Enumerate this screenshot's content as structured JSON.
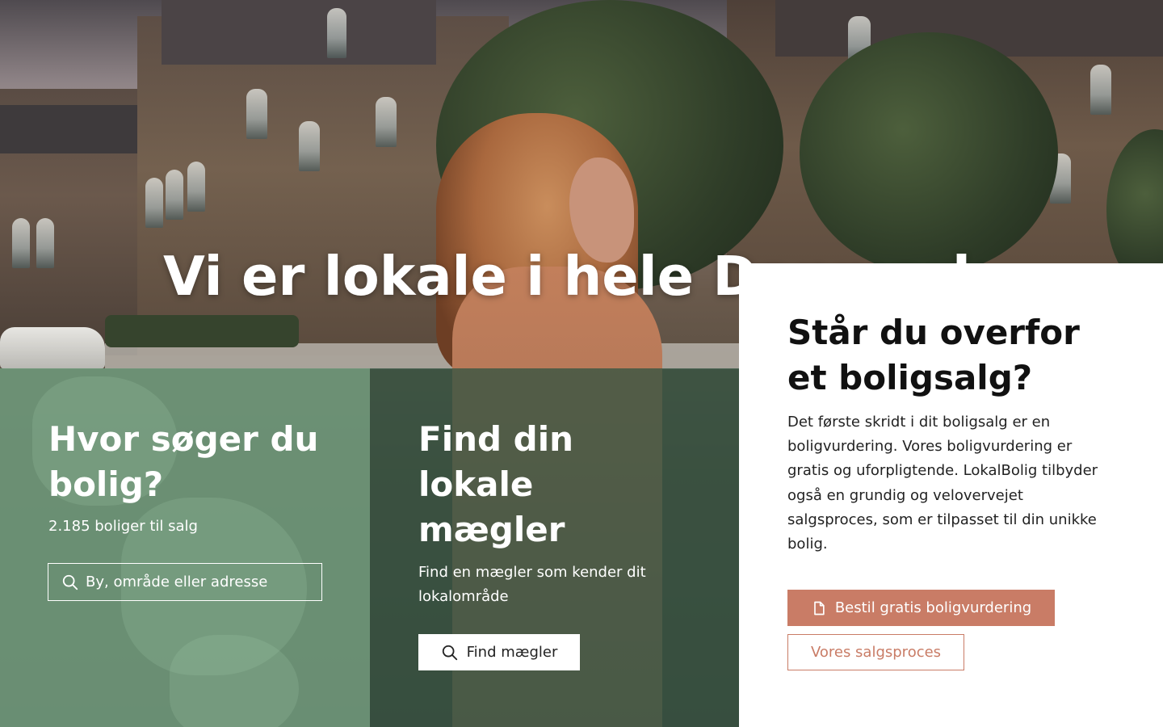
{
  "hero": {
    "headline": "Vi er lokale i hele Danmark"
  },
  "search_panel": {
    "title": "Hvor søger du bolig?",
    "subtitle": "2.185 boliger til salg",
    "search_placeholder": "By, område eller adresse",
    "icon": "search-icon",
    "background_color": "#6e9678"
  },
  "agent_panel": {
    "title": "Find din lokale mægler",
    "subtitle": "Find en mægler som kender dit lokalområde",
    "button_label": "Find mægler",
    "icon": "search-icon",
    "background_color": "#365442"
  },
  "sale_panel": {
    "title": "Står du overfor et boligsalg?",
    "body": "Det første skridt i dit boligsalg er en boligvurdering. Vores boligvurdering er gratis og uforpligtende. LokalBolig tilbyder også en grundig og velovervejet salgsproces, som er tilpasset til din unikke bolig.",
    "primary_button": "Bestil gratis boligvurdering",
    "primary_icon": "document-icon",
    "secondary_button": "Vores salgsproces",
    "accent_color": "#c97c66"
  }
}
